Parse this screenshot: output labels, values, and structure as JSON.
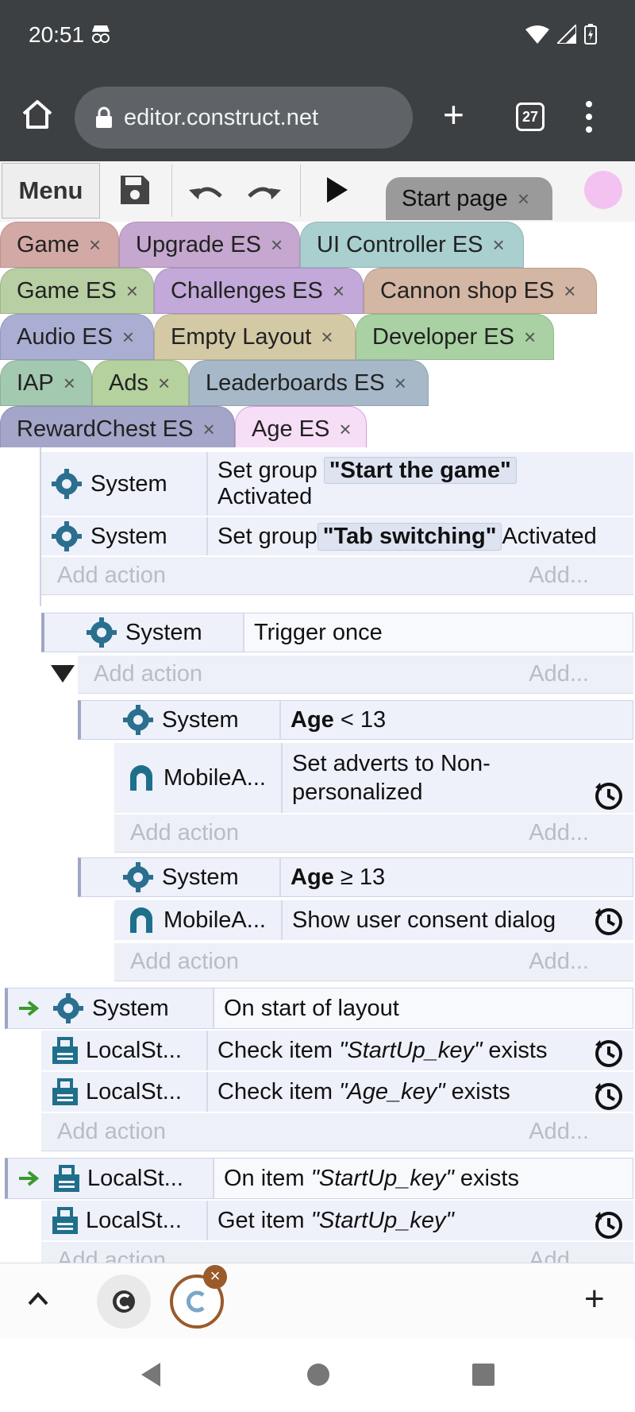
{
  "status": {
    "time": "20:51"
  },
  "browser": {
    "url": "editor.construct.net",
    "tab_count": "27"
  },
  "toolbar": {
    "menu_label": "Menu",
    "start_page_tab": "Start page"
  },
  "tabs": {
    "row1": [
      "Game",
      "Upgrade ES",
      "UI Controller ES"
    ],
    "row2": [
      "Game ES",
      "Challenges ES",
      "Cannon shop ES"
    ],
    "row3": [
      "Audio ES",
      "Empty Layout",
      "Developer ES"
    ],
    "row4": [
      "IAP",
      "Ads",
      "Leaderboards ES"
    ],
    "row5": [
      "RewardChest ES",
      "Age ES"
    ],
    "close_glyph": "×"
  },
  "events": {
    "add_action": "Add action",
    "add_short": "Add...",
    "system": "System",
    "mobile": "MobileA...",
    "local": "LocalSt...",
    "e1": {
      "a1_pre": "Set group ",
      "a1_param": "\"Start the game\"",
      "a1_post": "Activated",
      "a2_pre": "Set group ",
      "a2_param": "\"Tab switching\"",
      "a2_post": " Activated"
    },
    "e2": {
      "cond": "Trigger once"
    },
    "e3": {
      "cond_bold": "Age",
      "cond_rest": " < 13",
      "action": "Set adverts to Non-personalized"
    },
    "e4": {
      "cond_bold": "Age",
      "cond_rest": " ≥ 13",
      "action": "Show user consent dialog"
    },
    "e5": {
      "cond": "On start of layout",
      "a1_pre": "Check item ",
      "a1_param": "\"StartUp_key\"",
      "a1_post": " exists",
      "a2_pre": "Check item ",
      "a2_param": "\"Age_key\"",
      "a2_post": " exists"
    },
    "e6": {
      "cond_pre": "On item ",
      "cond_param": "\"StartUp_key\"",
      "cond_post": " exists",
      "a1_pre": "Get item ",
      "a1_param": "\"StartUp_key\""
    }
  }
}
